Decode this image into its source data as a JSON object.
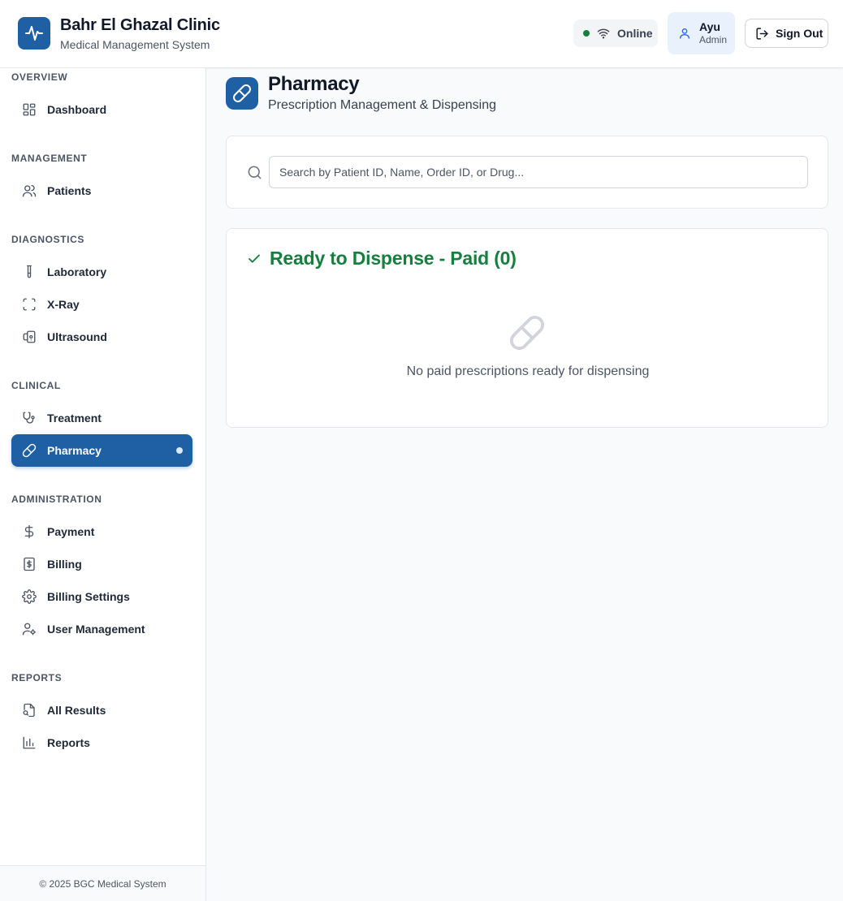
{
  "header": {
    "title": "Bahr El Ghazal Clinic",
    "subtitle": "Medical Management System",
    "status": "Online",
    "user_name": "Ayu",
    "user_role": "Admin",
    "signout_label": "Sign Out"
  },
  "sidebar": {
    "sections": {
      "overview": "OVERVIEW",
      "management": "MANAGEMENT",
      "diagnostics": "DIAGNOSTICS",
      "clinical": "CLINICAL",
      "administration": "ADMINISTRATION",
      "reports": "REPORTS"
    },
    "items": {
      "dashboard": "Dashboard",
      "patients": "Patients",
      "laboratory": "Laboratory",
      "xray": "X-Ray",
      "ultrasound": "Ultrasound",
      "treatment": "Treatment",
      "pharmacy": "Pharmacy",
      "payment": "Payment",
      "billing": "Billing",
      "billing_settings": "Billing Settings",
      "user_management": "User Management",
      "all_results": "All Results",
      "reports": "Reports"
    },
    "active_item": "pharmacy",
    "footer": "© 2025 BGC Medical System"
  },
  "main": {
    "title": "Pharmacy",
    "subtitle": "Prescription Management & Dispensing",
    "search": {
      "placeholder": "Search by Patient ID, Name, Order ID, or Drug...",
      "value": ""
    },
    "dispense": {
      "title": "Ready to Dispense - Paid (0)",
      "empty_message": "No paid prescriptions ready for dispensing"
    }
  },
  "colors": {
    "brand": "#1f5fa3",
    "success": "#15803d",
    "online_dot": "#15803d"
  },
  "icons": {
    "logo": "activity-pulse-icon",
    "status": "wifi-icon",
    "user": "user-icon",
    "signout": "log-out-icon",
    "page": "pill-icon",
    "search": "search-icon",
    "dispense": "check-icon"
  }
}
